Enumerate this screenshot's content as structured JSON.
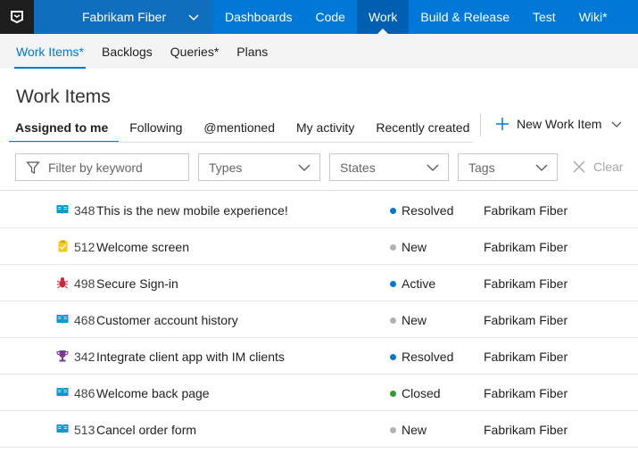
{
  "topbar": {
    "project": "Fabrikam Fiber",
    "nav": [
      "Dashboards",
      "Code",
      "Work",
      "Build & Release",
      "Test",
      "Wiki*"
    ],
    "selected_index": 2
  },
  "subnav": {
    "items": [
      "Work Items*",
      "Backlogs",
      "Queries*",
      "Plans"
    ],
    "selected_index": 0
  },
  "page_title": "Work Items",
  "pivots": {
    "items": [
      "Assigned to me",
      "Following",
      "@mentioned",
      "My activity",
      "Recently created"
    ],
    "selected_index": 0
  },
  "new_work_item": "New Work Item",
  "filters": {
    "keyword_placeholder": "Filter by keyword",
    "types": "Types",
    "states": "States",
    "tags": "Tags",
    "clear": "Clear"
  },
  "colors": {
    "accent": "#0078d7",
    "resolved": "#0078d7",
    "new": "#b2b2b2",
    "active": "#0078d7",
    "closed": "#339933",
    "story": "#009ccc",
    "task": "#f2cb1d",
    "bug": "#cc293d",
    "feature": "#773b93"
  },
  "work_items": [
    {
      "id": "348",
      "title": "This is the new mobile experience!",
      "state": "Resolved",
      "area": "Fabrikam Fiber",
      "icon": "book-icon"
    },
    {
      "id": "512",
      "title": "Welcome screen",
      "state": "New",
      "area": "Fabrikam Fiber",
      "icon": "clipboard-icon"
    },
    {
      "id": "498",
      "title": "Secure Sign-in",
      "state": "Active",
      "area": "Fabrikam Fiber",
      "icon": "bug-icon"
    },
    {
      "id": "468",
      "title": "Customer account history",
      "state": "New",
      "area": "Fabrikam Fiber",
      "icon": "book-icon"
    },
    {
      "id": "342",
      "title": "Integrate client app with IM clients",
      "state": "Resolved",
      "area": "Fabrikam Fiber",
      "icon": "trophy-icon"
    },
    {
      "id": "486",
      "title": "Welcome back page",
      "state": "Closed",
      "area": "Fabrikam Fiber",
      "icon": "book-icon"
    },
    {
      "id": "513",
      "title": "Cancel order form",
      "state": "New",
      "area": "Fabrikam Fiber",
      "icon": "book-icon"
    }
  ]
}
